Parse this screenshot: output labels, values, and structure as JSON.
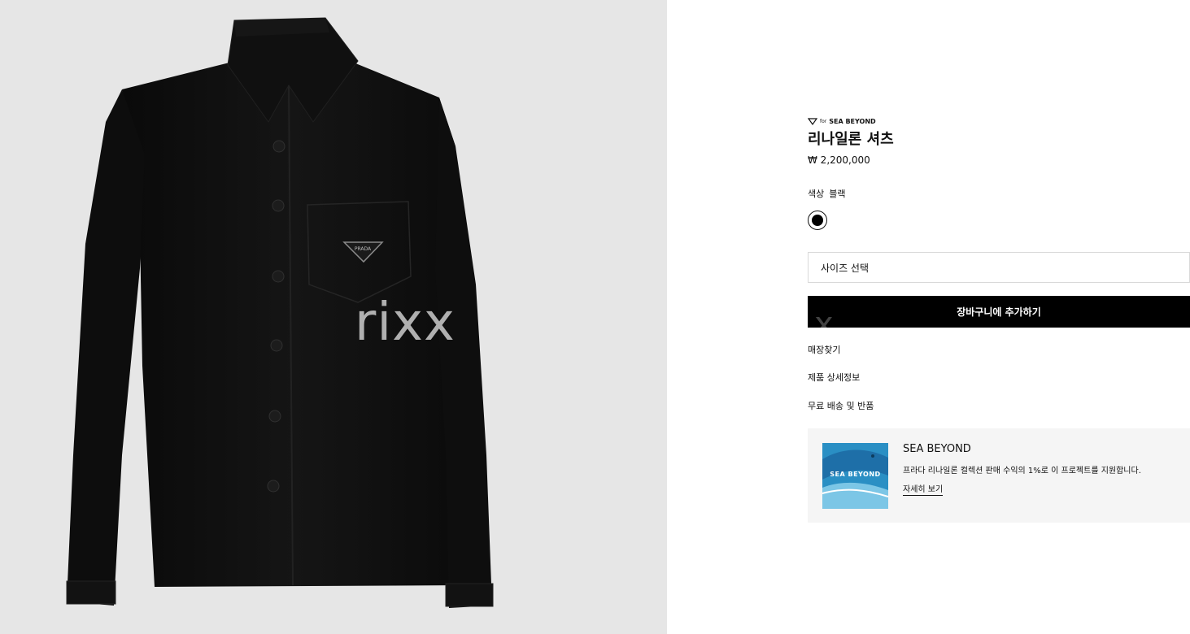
{
  "gallery": {
    "image": "black-nylon-shirt-photo",
    "watermark": "rixx",
    "logo_text": "PRADA"
  },
  "product": {
    "badge_for": "for",
    "badge_brand": "SEA BEYOND",
    "title": "리나일론 셔츠",
    "price": "₩ 2,200,000",
    "color_label": "색상",
    "color_value": "블랙",
    "swatch_color": "#000000"
  },
  "size_select": {
    "placeholder": "사이즈 선택"
  },
  "cart_button": {
    "label": "장바구니에 추가하기",
    "ghost": "x"
  },
  "links": {
    "store": "매장찾기",
    "details": "제품 상세정보",
    "shipping": "무료 배송 및 반품"
  },
  "sea_beyond": {
    "thumb_label": "SEA BEYOND",
    "title": "SEA BEYOND",
    "description": "프라다 리나일론 컬렉션 판매 수익의 1%로 이 프로젝트를 지원합니다.",
    "more_link": "자세히 보기"
  }
}
